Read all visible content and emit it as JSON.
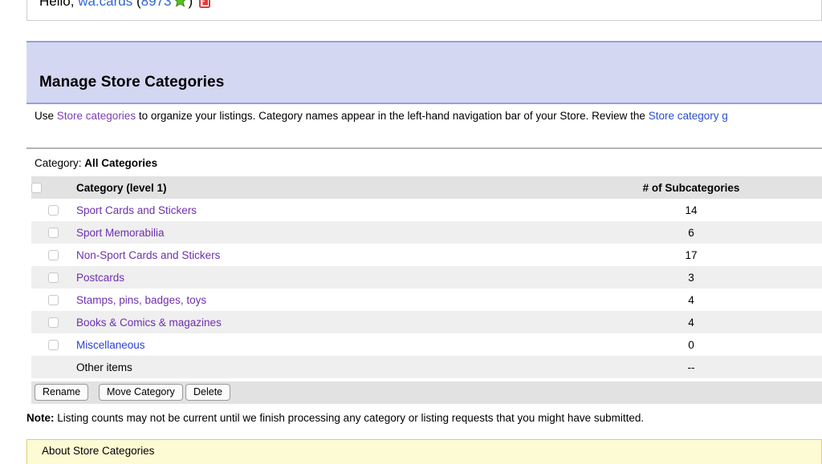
{
  "greeting": {
    "hello_text": "Hello,",
    "user_name": "wa.cards",
    "open_paren": "(",
    "feedback_score": "8973",
    "close_paren": ")",
    "star_icon": "green-star-icon",
    "me_icon": "me-doorway-icon",
    "star_color": "#55c21e",
    "me_color": "#e03a3a"
  },
  "banner": {
    "title": "Manage Store Categories",
    "bg_color": "#d4d7f2",
    "border_color": "#9a9ddb"
  },
  "intro": {
    "before_link": "Use ",
    "link1": "Store categories",
    "middle": " to organize your listings. Category names appear in the left-hand navigation bar of your Store. Review the ",
    "link2": "Store category g"
  },
  "category_selector": {
    "label": "Category:",
    "value": "All Categories"
  },
  "table": {
    "columns": {
      "checkbox": "",
      "name": "Category (level 1)",
      "count": "# of Subcategories"
    },
    "rows": [
      {
        "name": "Sport Cards and Stickers",
        "count": "14",
        "link_state": "visited",
        "has_checkbox": true
      },
      {
        "name": "Sport Memorabilia",
        "count": "6",
        "link_state": "visited",
        "has_checkbox": true
      },
      {
        "name": "Non-Sport Cards and Stickers",
        "count": "17",
        "link_state": "visited",
        "has_checkbox": true
      },
      {
        "name": "Postcards",
        "count": "3",
        "link_state": "visited",
        "has_checkbox": true
      },
      {
        "name": "Stamps, pins, badges, toys",
        "count": "4",
        "link_state": "visited",
        "has_checkbox": true
      },
      {
        "name": "Books & Comics & magazines",
        "count": "4",
        "link_state": "visited",
        "has_checkbox": true
      },
      {
        "name": "Miscellaneous",
        "count": "0",
        "link_state": "new",
        "has_checkbox": true
      },
      {
        "name": "Other items",
        "count": "--",
        "link_state": "plain",
        "has_checkbox": false
      }
    ]
  },
  "buttons": {
    "rename": "Rename",
    "move_category": "Move Category",
    "delete": "Delete"
  },
  "note": {
    "label": "Note:",
    "text": " Listing counts may not be current until we finish processing any category or listing requests that you might have submitted."
  },
  "about": {
    "title": "About Store Categories",
    "bg_color": "#fdfbd4",
    "border_color": "#e0cf6a"
  }
}
